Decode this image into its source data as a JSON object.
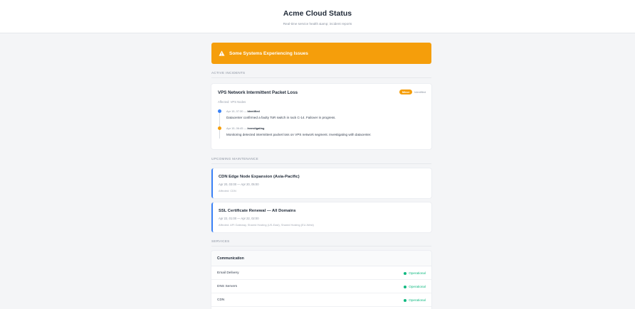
{
  "header": {
    "title": "Acme Cloud Status",
    "subtitle": "Real-time service health &amp; incident reports"
  },
  "banner": {
    "icon": "warning-icon",
    "text": "Some Systems Experiencing Issues",
    "color": "#f59e0b"
  },
  "sections": {
    "active_incidents": "ACTIVE INCIDENTS",
    "upcoming_maintenance": "UPCOMING MAINTENANCE",
    "services": "SERVICES"
  },
  "incidents": [
    {
      "title": "VPS Network Intermittent Packet Loss",
      "severity": "Minor",
      "status": "Identified",
      "affected": "Affected: VPS Nodes",
      "updates": [
        {
          "time": "Apr 15, 07:30",
          "separator": " — ",
          "state": "Identified",
          "text": "Datacenter confirmed a faulty ToR switch in rack C-14. Failover in progress.",
          "dot_color": "#3b82f6"
        },
        {
          "time": "Apr 15, 06:45",
          "separator": " — ",
          "state": "Investigating",
          "text": "Monitoring detected intermittent packet loss on VPS network segment. Investigating with datacenter.",
          "dot_color": "#f59e0b"
        }
      ]
    }
  ],
  "maintenance": [
    {
      "title": "CDN Edge Node Expansion (Asia-Pacific)",
      "time": "Apr 20, 03:00 — Apr 20, 05:00",
      "affected": "Affected: CDN"
    },
    {
      "title": "SSL Certificate Renewal — All Domains",
      "time": "Apr 22, 01:00 — Apr 22, 02:00",
      "affected": "Affected: API Gateway, Shared Hosting (US-East), Shared Hosting (EU-West)"
    }
  ],
  "services": {
    "group": "Communication",
    "items": [
      {
        "name": "Email Delivery",
        "status": "Operational"
      },
      {
        "name": "DNS Servers",
        "status": "Operational"
      },
      {
        "name": "CDN",
        "status": "Operational"
      }
    ],
    "status_color": "#10b981"
  },
  "colors": {
    "accent": "#f59e0b",
    "maintenance_border": "#3b82f6",
    "operational": "#10b981"
  }
}
